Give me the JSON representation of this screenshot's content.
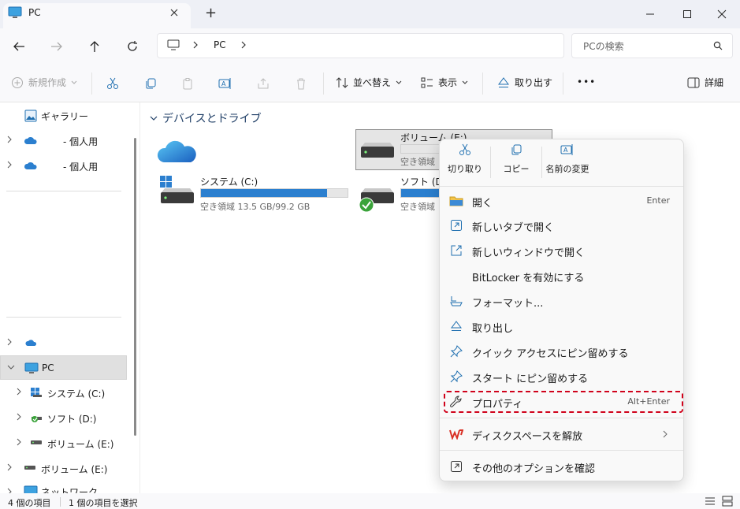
{
  "window": {
    "tab_title": "PC",
    "new_tab": "+"
  },
  "address": {
    "location": "PC",
    "search_placeholder": "PCの検索"
  },
  "toolbar": {
    "new": "新規作成",
    "sort": "並べ替え",
    "view": "表示",
    "eject": "取り出す",
    "more": "•••",
    "details": "詳細"
  },
  "sidebar": {
    "gallery": "ギャラリー",
    "onedrive1": "- 個人用",
    "onedrive2": "- 個人用",
    "pc": "PC",
    "drive_c": "システム (C:)",
    "drive_d": "ソフト (D:)",
    "drive_e": "ボリューム (E:)",
    "drive_e2": "ボリューム (E:)",
    "network": "ネットワーク"
  },
  "content": {
    "group_title": "デバイスとドライブ",
    "drives": [
      {
        "name": "システム (C:)",
        "free": "空き領域 13.5 GB/99.2 GB",
        "used_fraction": 0.86
      },
      {
        "name": "ソフト (D:)",
        "free": "空き領域",
        "used_fraction": 0.86
      },
      {
        "name": "ボリューム (E:)",
        "free": "空き領域",
        "used_fraction": 0.0
      }
    ]
  },
  "context_menu": {
    "cut": "切り取り",
    "copy": "コピー",
    "rename": "名前の変更",
    "items": [
      {
        "label": "開く",
        "accel": "Enter"
      },
      {
        "label": "新しいタブで開く",
        "accel": ""
      },
      {
        "label": "新しいウィンドウで開く",
        "accel": ""
      },
      {
        "label": "BitLocker を有効にする",
        "accel": ""
      },
      {
        "label": "フォーマット...",
        "accel": ""
      },
      {
        "label": "取り出し",
        "accel": ""
      },
      {
        "label": "クイック アクセスにピン留めする",
        "accel": ""
      },
      {
        "label": "スタート にピン留めする",
        "accel": ""
      },
      {
        "label": "プロパティ",
        "accel": "Alt+Enter"
      },
      {
        "label": "ディスクスペースを解放",
        "accel": ""
      },
      {
        "label": "その他のオプションを確認",
        "accel": ""
      }
    ]
  },
  "status": {
    "item_count": "4 個の項目",
    "selected": "1 個の項目を選択"
  },
  "colors": {
    "accent": "#2b7fcf",
    "highlight_dashed": "#d0021b"
  }
}
